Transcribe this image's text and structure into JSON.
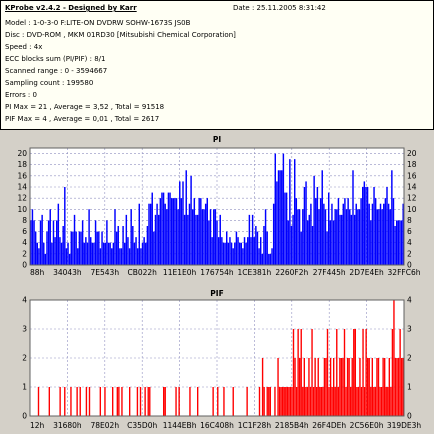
{
  "header": {
    "title": "KProbe v2.4.2 - Designed by Karr",
    "date": "Date : 25.11.2005 8:31:42",
    "lines": [
      "Model : 1-0-3-0 F:LITE-ON DVDRW SOHW-1673S JS0B",
      "Disc : DVD-ROM , MKM 01RD30  [Mitsubishi Chemical Corporation]",
      "Speed : 4x",
      "ECC blocks sum (PI/PIF) : 8/1",
      "Scanned range : 0 - 3594667",
      "Sampling count : 199580",
      "Errors : 0",
      "PI Max = 21 , Average = 3,52 , Total = 91518",
      "PIF Max = 4 , Average = 0,01 , Total = 2617"
    ]
  },
  "chart_data": [
    {
      "type": "bar",
      "title": "PI",
      "ylim": [
        0,
        21
      ],
      "yticks": [
        0,
        2,
        4,
        6,
        8,
        10,
        12,
        14,
        16,
        18,
        20
      ],
      "xticks": [
        "88h",
        "34043h",
        "7E543h",
        "CB022h",
        "11E1E0h",
        "176754h",
        "1CE381h",
        "2260F2h",
        "27F445h",
        "2D7E4Eh",
        "32FFC6h"
      ],
      "grid": true,
      "color": "#0000ff",
      "values": [
        8,
        10,
        8,
        6,
        4,
        3,
        8,
        9,
        4,
        2,
        6,
        8,
        10,
        4,
        8,
        5,
        8,
        11,
        5,
        4,
        7,
        14,
        3,
        4,
        2,
        6,
        6,
        9,
        6,
        3,
        6,
        6,
        8,
        4,
        5,
        4,
        10,
        5,
        4,
        4,
        8,
        6,
        6,
        3,
        6,
        4,
        4,
        8,
        4,
        4,
        3,
        4,
        10,
        6,
        7,
        3,
        3,
        7,
        4,
        9,
        5,
        3,
        10,
        7,
        4,
        5,
        3,
        11,
        3,
        4,
        5,
        4,
        7,
        11,
        11,
        13,
        6,
        9,
        11,
        9,
        12,
        13,
        13,
        11,
        10,
        13,
        13,
        12,
        12,
        12,
        12,
        10,
        15,
        12,
        15,
        9,
        17,
        9,
        11,
        16,
        10,
        12,
        9,
        9,
        12,
        12,
        10,
        10,
        11,
        12,
        8,
        10,
        5,
        10,
        10,
        8,
        5,
        9,
        5,
        4,
        4,
        6,
        4,
        5,
        4,
        3,
        4,
        6,
        5,
        4,
        4,
        3,
        5,
        4,
        5,
        9,
        5,
        9,
        5,
        7,
        6,
        3,
        5,
        2,
        7,
        10,
        6,
        2,
        2,
        3,
        11,
        20,
        15,
        17,
        17,
        17,
        20,
        13,
        13,
        8,
        19,
        7,
        9,
        19,
        12,
        10,
        10,
        6,
        10,
        14,
        15,
        8,
        9,
        11,
        7,
        16,
        12,
        14,
        10,
        12,
        17,
        11,
        10,
        6,
        13,
        8,
        11,
        8,
        10,
        10,
        12,
        9,
        9,
        11,
        12,
        10,
        12,
        10,
        9,
        17,
        9,
        11,
        10,
        10,
        12,
        14,
        15,
        14,
        14,
        11,
        8,
        11,
        14,
        12,
        10,
        10,
        11,
        10,
        11,
        12,
        14,
        11,
        10,
        17,
        12,
        7,
        8,
        8,
        8,
        8,
        11
      ]
    },
    {
      "type": "bar",
      "title": "PIF",
      "ylim": [
        0,
        4
      ],
      "yticks": [
        0,
        1,
        2,
        3,
        4
      ],
      "xticks": [
        "12h",
        "31680h",
        "78E02h",
        "C35D0h",
        "1144EBh",
        "16C408h",
        "1C1F28h",
        "2185B4h",
        "26F4DEh",
        "2C56E0h",
        "319DE3h"
      ],
      "grid": true,
      "color": "#ff0000",
      "values": [
        0,
        0,
        0,
        0,
        0,
        1,
        0,
        0,
        0,
        0,
        0,
        0,
        1,
        0,
        0,
        0,
        0,
        0,
        0,
        1,
        0,
        0,
        1,
        0,
        0,
        0,
        1,
        0,
        0,
        0,
        1,
        0,
        1,
        0,
        0,
        0,
        1,
        0,
        1,
        0,
        0,
        0,
        0,
        0,
        0,
        1,
        0,
        0,
        1,
        0,
        0,
        0,
        0,
        1,
        0,
        0,
        1,
        1,
        0,
        1,
        0,
        0,
        0,
        0,
        1,
        0,
        0,
        0,
        0,
        1,
        0,
        1,
        0,
        0,
        1,
        0,
        1,
        1,
        0,
        0,
        0,
        0,
        0,
        0,
        0,
        0,
        1,
        1,
        0,
        0,
        0,
        0,
        0,
        0,
        1,
        0,
        1,
        0,
        0,
        0,
        0,
        0,
        0,
        1,
        0,
        0,
        0,
        0,
        1,
        0,
        0,
        0,
        0,
        0,
        0,
        0,
        0,
        0,
        1,
        0,
        0,
        1,
        0,
        0,
        0,
        1,
        0,
        0,
        0,
        0,
        0,
        1,
        0,
        0,
        0,
        0,
        0,
        0,
        0,
        0,
        1,
        0,
        0,
        0,
        0,
        0,
        0,
        0,
        1,
        0,
        2,
        1,
        0,
        1,
        1,
        1,
        0,
        0,
        1,
        0,
        2,
        1,
        1,
        1,
        1,
        1,
        1,
        1,
        1,
        1,
        3,
        2,
        1,
        3,
        2,
        3,
        1,
        2,
        1,
        1,
        2,
        1,
        3,
        1,
        2,
        1,
        2,
        1,
        1,
        1,
        2,
        2,
        3,
        1,
        2,
        1,
        2,
        1,
        3,
        1,
        2,
        2,
        2,
        3,
        1,
        2,
        2,
        1,
        2,
        3,
        3,
        1,
        1,
        2,
        1,
        3,
        1,
        3,
        2,
        2,
        1,
        2,
        1,
        1,
        2,
        2,
        1,
        1,
        2,
        2,
        1,
        1,
        2,
        1,
        3,
        4,
        2,
        2,
        2,
        3,
        2,
        2
      ]
    }
  ]
}
